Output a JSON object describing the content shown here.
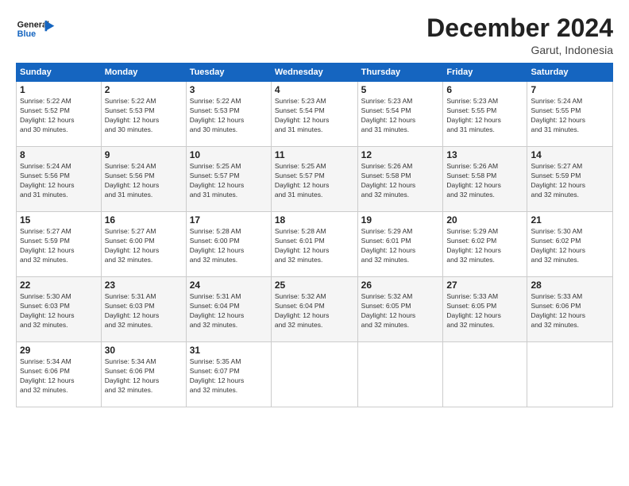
{
  "header": {
    "logo_line1": "General",
    "logo_line2": "Blue",
    "month_title": "December 2024",
    "location": "Garut, Indonesia"
  },
  "weekdays": [
    "Sunday",
    "Monday",
    "Tuesday",
    "Wednesday",
    "Thursday",
    "Friday",
    "Saturday"
  ],
  "weeks": [
    [
      {
        "day": 1,
        "info": "Sunrise: 5:22 AM\nSunset: 5:52 PM\nDaylight: 12 hours\nand 30 minutes."
      },
      {
        "day": 2,
        "info": "Sunrise: 5:22 AM\nSunset: 5:53 PM\nDaylight: 12 hours\nand 30 minutes."
      },
      {
        "day": 3,
        "info": "Sunrise: 5:22 AM\nSunset: 5:53 PM\nDaylight: 12 hours\nand 30 minutes."
      },
      {
        "day": 4,
        "info": "Sunrise: 5:23 AM\nSunset: 5:54 PM\nDaylight: 12 hours\nand 31 minutes."
      },
      {
        "day": 5,
        "info": "Sunrise: 5:23 AM\nSunset: 5:54 PM\nDaylight: 12 hours\nand 31 minutes."
      },
      {
        "day": 6,
        "info": "Sunrise: 5:23 AM\nSunset: 5:55 PM\nDaylight: 12 hours\nand 31 minutes."
      },
      {
        "day": 7,
        "info": "Sunrise: 5:24 AM\nSunset: 5:55 PM\nDaylight: 12 hours\nand 31 minutes."
      }
    ],
    [
      {
        "day": 8,
        "info": "Sunrise: 5:24 AM\nSunset: 5:56 PM\nDaylight: 12 hours\nand 31 minutes."
      },
      {
        "day": 9,
        "info": "Sunrise: 5:24 AM\nSunset: 5:56 PM\nDaylight: 12 hours\nand 31 minutes."
      },
      {
        "day": 10,
        "info": "Sunrise: 5:25 AM\nSunset: 5:57 PM\nDaylight: 12 hours\nand 31 minutes."
      },
      {
        "day": 11,
        "info": "Sunrise: 5:25 AM\nSunset: 5:57 PM\nDaylight: 12 hours\nand 31 minutes."
      },
      {
        "day": 12,
        "info": "Sunrise: 5:26 AM\nSunset: 5:58 PM\nDaylight: 12 hours\nand 32 minutes."
      },
      {
        "day": 13,
        "info": "Sunrise: 5:26 AM\nSunset: 5:58 PM\nDaylight: 12 hours\nand 32 minutes."
      },
      {
        "day": 14,
        "info": "Sunrise: 5:27 AM\nSunset: 5:59 PM\nDaylight: 12 hours\nand 32 minutes."
      }
    ],
    [
      {
        "day": 15,
        "info": "Sunrise: 5:27 AM\nSunset: 5:59 PM\nDaylight: 12 hours\nand 32 minutes."
      },
      {
        "day": 16,
        "info": "Sunrise: 5:27 AM\nSunset: 6:00 PM\nDaylight: 12 hours\nand 32 minutes."
      },
      {
        "day": 17,
        "info": "Sunrise: 5:28 AM\nSunset: 6:00 PM\nDaylight: 12 hours\nand 32 minutes."
      },
      {
        "day": 18,
        "info": "Sunrise: 5:28 AM\nSunset: 6:01 PM\nDaylight: 12 hours\nand 32 minutes."
      },
      {
        "day": 19,
        "info": "Sunrise: 5:29 AM\nSunset: 6:01 PM\nDaylight: 12 hours\nand 32 minutes."
      },
      {
        "day": 20,
        "info": "Sunrise: 5:29 AM\nSunset: 6:02 PM\nDaylight: 12 hours\nand 32 minutes."
      },
      {
        "day": 21,
        "info": "Sunrise: 5:30 AM\nSunset: 6:02 PM\nDaylight: 12 hours\nand 32 minutes."
      }
    ],
    [
      {
        "day": 22,
        "info": "Sunrise: 5:30 AM\nSunset: 6:03 PM\nDaylight: 12 hours\nand 32 minutes."
      },
      {
        "day": 23,
        "info": "Sunrise: 5:31 AM\nSunset: 6:03 PM\nDaylight: 12 hours\nand 32 minutes."
      },
      {
        "day": 24,
        "info": "Sunrise: 5:31 AM\nSunset: 6:04 PM\nDaylight: 12 hours\nand 32 minutes."
      },
      {
        "day": 25,
        "info": "Sunrise: 5:32 AM\nSunset: 6:04 PM\nDaylight: 12 hours\nand 32 minutes."
      },
      {
        "day": 26,
        "info": "Sunrise: 5:32 AM\nSunset: 6:05 PM\nDaylight: 12 hours\nand 32 minutes."
      },
      {
        "day": 27,
        "info": "Sunrise: 5:33 AM\nSunset: 6:05 PM\nDaylight: 12 hours\nand 32 minutes."
      },
      {
        "day": 28,
        "info": "Sunrise: 5:33 AM\nSunset: 6:06 PM\nDaylight: 12 hours\nand 32 minutes."
      }
    ],
    [
      {
        "day": 29,
        "info": "Sunrise: 5:34 AM\nSunset: 6:06 PM\nDaylight: 12 hours\nand 32 minutes."
      },
      {
        "day": 30,
        "info": "Sunrise: 5:34 AM\nSunset: 6:06 PM\nDaylight: 12 hours\nand 32 minutes."
      },
      {
        "day": 31,
        "info": "Sunrise: 5:35 AM\nSunset: 6:07 PM\nDaylight: 12 hours\nand 32 minutes."
      },
      null,
      null,
      null,
      null
    ]
  ]
}
